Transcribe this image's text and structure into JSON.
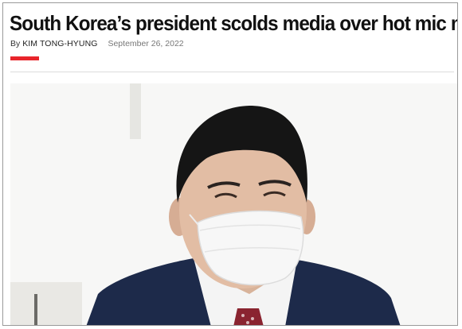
{
  "article": {
    "headline": "South Korea’s president scolds media over hot mic moment",
    "byline_prefix": "By",
    "author": "KIM TONG-HYUNG",
    "date": "September 26, 2022"
  },
  "colors": {
    "accent": "#e8252b",
    "headline": "#111111",
    "date": "#777777"
  },
  "photo": {
    "subject": "man in white face mask, dark suit and red patterned tie"
  }
}
